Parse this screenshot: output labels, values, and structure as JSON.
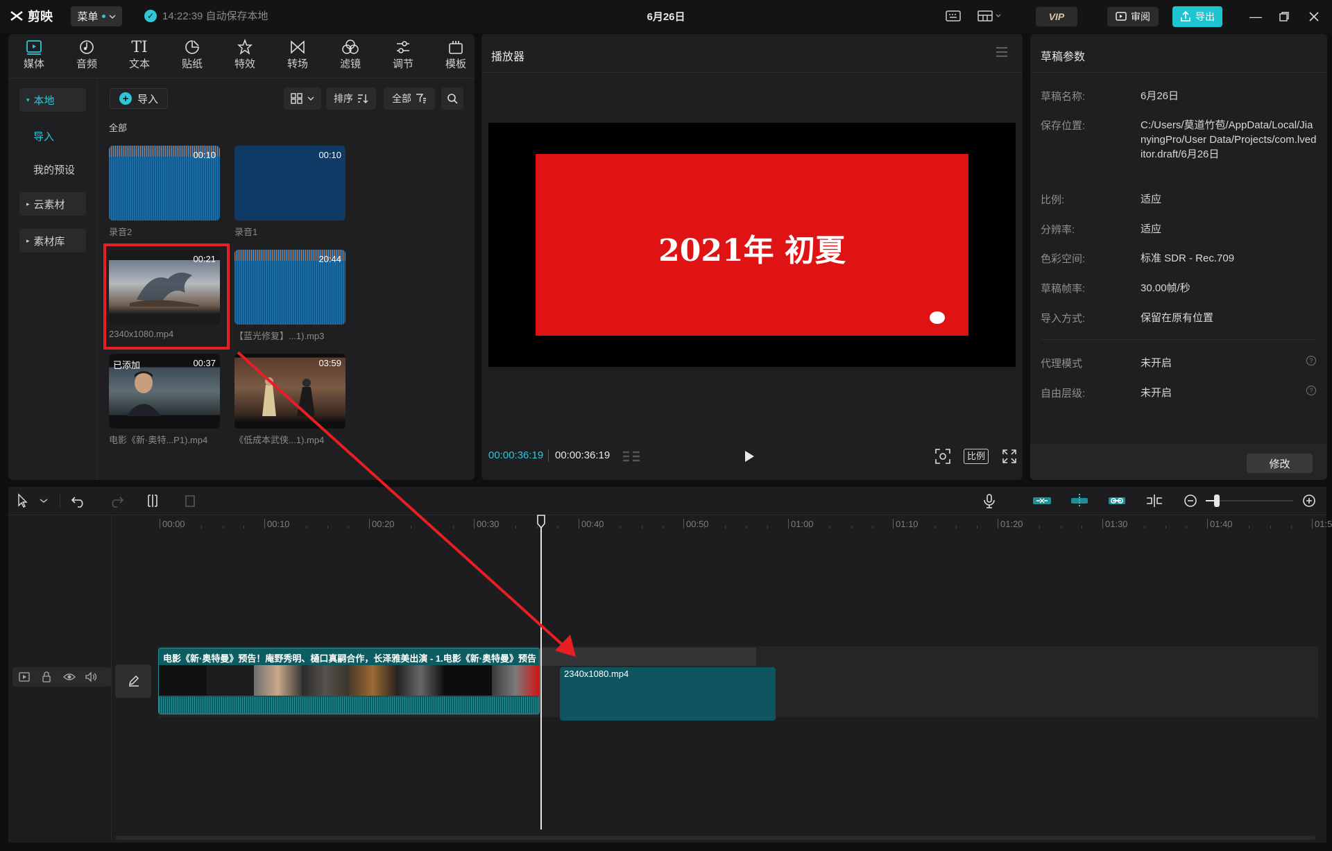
{
  "app": {
    "logo_text": "剪映",
    "menu_label": "菜单",
    "save_status": "14:22:39 自动保存本地",
    "project_title": "6月26日",
    "vip_label": "VIP",
    "review_label": "审阅",
    "export_label": "导出",
    "accent": "#2ec7d8"
  },
  "media_tabs": [
    {
      "label": "媒体",
      "icon": "media-icon",
      "active": true
    },
    {
      "label": "音频",
      "icon": "audio-icon"
    },
    {
      "label": "文本",
      "icon": "text-icon"
    },
    {
      "label": "贴纸",
      "icon": "sticker-icon"
    },
    {
      "label": "特效",
      "icon": "effects-icon"
    },
    {
      "label": "转场",
      "icon": "transition-icon"
    },
    {
      "label": "滤镜",
      "icon": "filter-icon"
    },
    {
      "label": "调节",
      "icon": "adjust-icon"
    },
    {
      "label": "模板",
      "icon": "template-icon"
    }
  ],
  "sidebar": {
    "local": "本地",
    "import": "导入",
    "my_presets": "我的预设",
    "cloud": "云素材",
    "library": "素材库"
  },
  "media": {
    "import_button": "导入",
    "sort_label": "排序",
    "filter_label": "全部",
    "section_label": "全部",
    "items": [
      {
        "name": "录音2",
        "duration": "00:10",
        "kind": "audio"
      },
      {
        "name": "录音1",
        "duration": "00:10",
        "kind": "audio-blank"
      },
      {
        "name": "2340x1080.mp4",
        "duration": "00:21",
        "kind": "video"
      },
      {
        "name": "【蓝光修复】...1).mp3",
        "duration": "20:44",
        "kind": "audio"
      },
      {
        "name": "电影《新·奥特...P1).mp4",
        "duration": "00:37",
        "kind": "video",
        "tag": "已添加"
      },
      {
        "name": "《低成本武侠...1).mp4",
        "duration": "03:59",
        "kind": "video"
      }
    ]
  },
  "player": {
    "title": "播放器",
    "video_text": "2021年 初夏",
    "current_time": "00:00:36:19",
    "total_time": "00:00:36:19",
    "ratio_label": "比例"
  },
  "params": {
    "title": "草稿参数",
    "rows": [
      {
        "label": "草稿名称:",
        "value": "6月26日"
      },
      {
        "label": "保存位置:",
        "value": "C:/Users/莫道竹苞/AppData/Local/JianyingPro/User Data/Projects/com.lveditor.draft/6月26日"
      },
      {
        "label": "比例:",
        "value": "适应"
      },
      {
        "label": "分辨率:",
        "value": "适应"
      },
      {
        "label": "色彩空间:",
        "value": "标准 SDR - Rec.709"
      },
      {
        "label": "草稿帧率:",
        "value": "30.00帧/秒"
      },
      {
        "label": "导入方式:",
        "value": "保留在原有位置"
      },
      {
        "label": "代理模式",
        "value": "未开启"
      },
      {
        "label": "自由层级:",
        "value": "未开启"
      }
    ],
    "modify_button": "修改"
  },
  "timeline": {
    "ruler": [
      "00:00",
      "00:10",
      "00:20",
      "00:30",
      "00:40",
      "00:50",
      "01:00",
      "01:10",
      "01:20",
      "01:30",
      "01:40",
      "01:5"
    ],
    "main_clip_title": "电影《新·奥特曼》预告！庵野秀明、樋口真嗣合作，长泽雅美出演 - 1.电影《新·奥特曼》预告",
    "new_clip_label": "2340x1080.mp4"
  }
}
